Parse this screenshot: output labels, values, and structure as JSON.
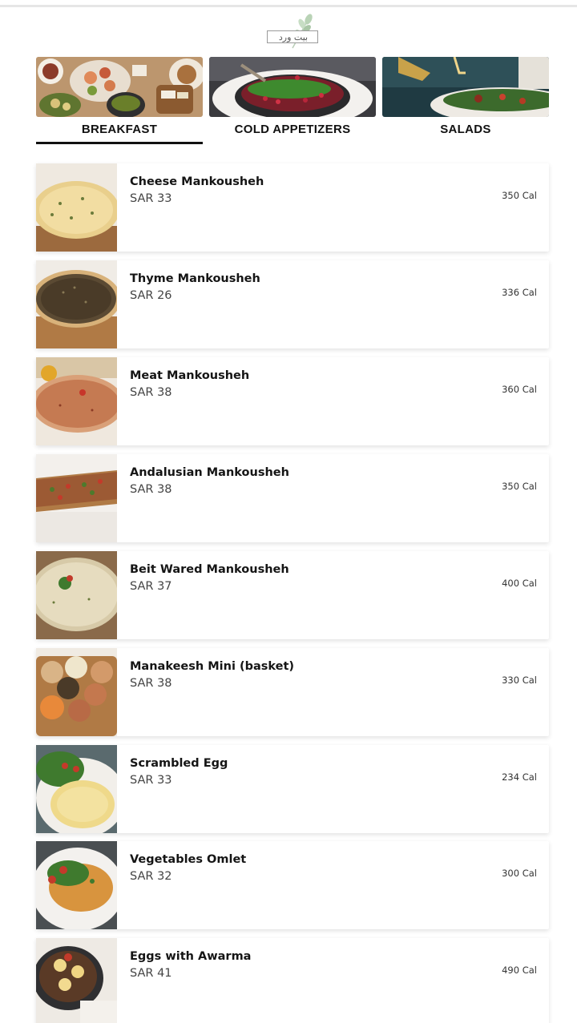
{
  "brand": {
    "logo_text": "بيت ورد"
  },
  "categories": [
    {
      "label": "BREAKFAST",
      "active": true
    },
    {
      "label": "COLD APPETIZERS",
      "active": false
    },
    {
      "label": "SALADS",
      "active": false
    }
  ],
  "items": [
    {
      "name": "Cheese Mankousheh",
      "price": "SAR 33",
      "calories": "350 Cal"
    },
    {
      "name": "Thyme Mankousheh",
      "price": "SAR 26",
      "calories": "336 Cal"
    },
    {
      "name": "Meat Mankousheh",
      "price": "SAR 38",
      "calories": "360 Cal"
    },
    {
      "name": "Andalusian Mankousheh",
      "price": "SAR 38",
      "calories": "350 Cal"
    },
    {
      "name": "Beit Wared Mankousheh",
      "price": "SAR 37",
      "calories": "400 Cal"
    },
    {
      "name": "Manakeesh Mini (basket)",
      "price": "SAR 38",
      "calories": "330 Cal"
    },
    {
      "name": "Scrambled Egg",
      "price": "SAR 33",
      "calories": "234 Cal"
    },
    {
      "name": "Vegetables Omlet",
      "price": "SAR 32",
      "calories": "300 Cal"
    },
    {
      "name": "Eggs with Awarma",
      "price": "SAR 41",
      "calories": "490 Cal"
    }
  ]
}
